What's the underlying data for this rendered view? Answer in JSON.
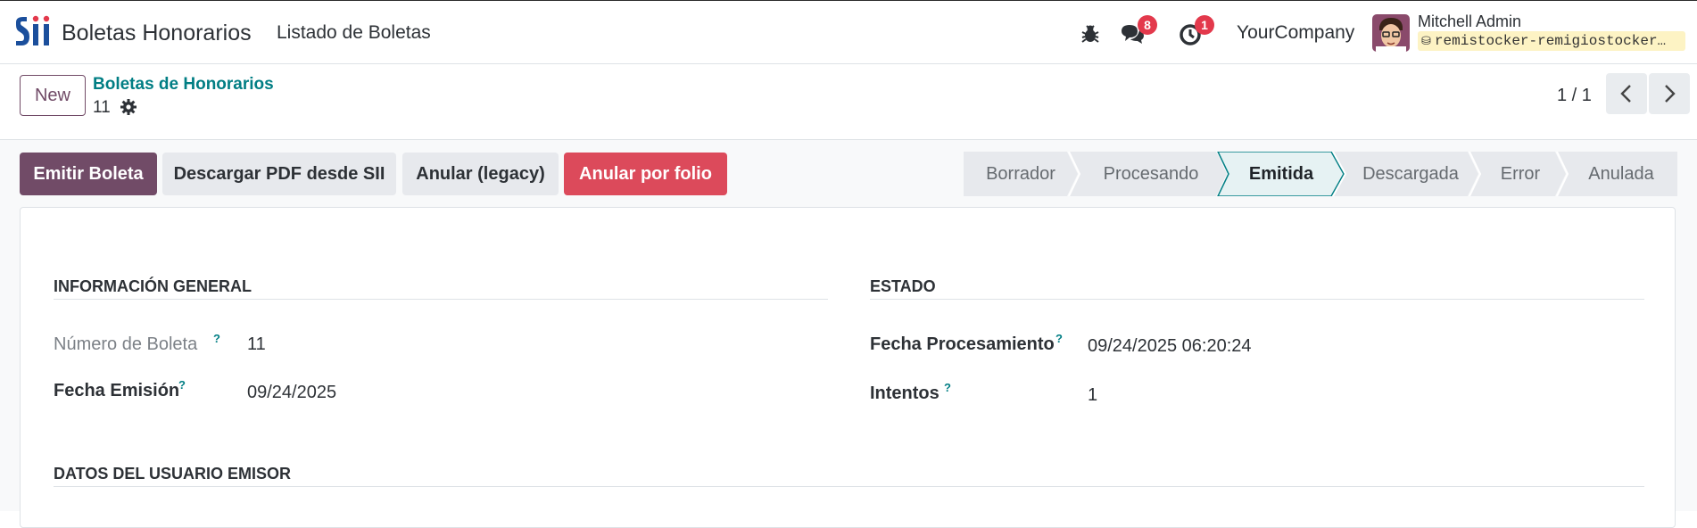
{
  "navbar": {
    "app_name": "Boletas Honorarios",
    "menu_item": "Listado de Boletas",
    "messages_count": "8",
    "activities_count": "1",
    "company": "YourCompany",
    "user_name": "Mitchell Admin",
    "database": "remistocker-remigiostocker…"
  },
  "control_panel": {
    "new_label": "New",
    "breadcrumb": "Boletas de Honorarios",
    "record_id": "11",
    "pager": "1 / 1"
  },
  "actions": {
    "emitir": "Emitir Boleta",
    "descargar": "Descargar PDF desde SII",
    "anular_legacy": "Anular (legacy)",
    "anular_folio": "Anular por folio"
  },
  "statusbar": {
    "stages": [
      "Borrador",
      "Procesando",
      "Emitida",
      "Descargada",
      "Error",
      "Anulada"
    ],
    "current": "Emitida"
  },
  "form": {
    "general": {
      "title": "INFORMACIÓN GENERAL",
      "numero_label": "Número de Boleta",
      "numero_value": "11",
      "fecha_label": "Fecha Emisión",
      "fecha_value": "09/24/2025"
    },
    "estado": {
      "title": "ESTADO",
      "fecha_proc_label": "Fecha Procesamiento",
      "fecha_proc_value": "09/24/2025 06:20:24",
      "intentos_label": "Intentos",
      "intentos_value": "1"
    },
    "emisor": {
      "title": "DATOS DEL USUARIO EMISOR"
    },
    "help_mark": "?"
  },
  "colors": {
    "brand": "#714b67",
    "link": "#017e84",
    "danger": "#dc4a5b",
    "badge": "#e3394c",
    "stage_active_border": "#017e84"
  }
}
